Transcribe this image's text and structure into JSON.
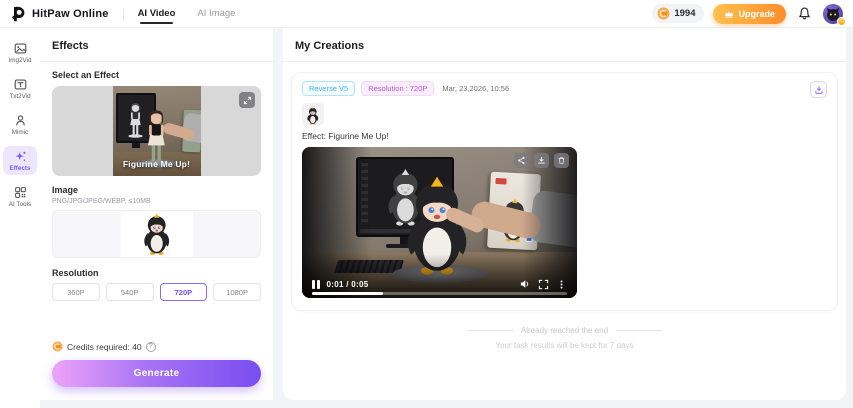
{
  "header": {
    "brand": "HitPaw Online",
    "tabs": [
      {
        "label": "AI Video",
        "active": true
      },
      {
        "label": "AI Image",
        "active": false
      }
    ],
    "credits": "1994",
    "upgrade_label": "Upgrade"
  },
  "sidebar": {
    "items": [
      {
        "label": "Img2Vid",
        "icon": "image-to-video-icon",
        "active": false
      },
      {
        "label": "Txt2Vid",
        "icon": "text-to-video-icon",
        "active": false
      },
      {
        "label": "Mimic",
        "icon": "person-icon",
        "active": false
      },
      {
        "label": "Effects",
        "icon": "sparkles-icon",
        "active": true
      },
      {
        "label": "AI Tools",
        "icon": "grid-tools-icon",
        "active": false
      }
    ]
  },
  "effects_panel": {
    "title": "Effects",
    "select_label": "Select an Effect",
    "effect_name": "Figurine Me Up!",
    "image_section": {
      "label": "Image",
      "formats": "PNG/JPG/JPEG/WEBP, ≤10MB"
    },
    "resolution": {
      "label": "Resolution",
      "options": [
        {
          "label": "360P",
          "selected": false
        },
        {
          "label": "540P",
          "selected": false
        },
        {
          "label": "720P",
          "selected": true
        },
        {
          "label": "1080P",
          "selected": false
        }
      ]
    },
    "credits_note": "Credits required: 40",
    "generate_label": "Generate"
  },
  "creations_panel": {
    "title": "My Creations",
    "card": {
      "model_badge": "Reverse V5",
      "resolution_badge": "Resolution : 720P",
      "timestamp": "Mar, 23,2026, 10:56",
      "effect_label": "Effect: Figurine Me Up!",
      "player": {
        "time_display": "0:01 / 0:05",
        "progress_percent": 28
      }
    },
    "end_message": "Already reached the end",
    "retention_message": "Your task results will be kept for 7 days"
  },
  "colors": {
    "accent_purple": "#7a5af5",
    "brand_orange": "#ff8d2a",
    "generate_gradient_start": "#eda4f8",
    "generate_gradient_end": "#7a4df0",
    "upgrade_gradient_start": "#ffc14e",
    "upgrade_gradient_end": "#ff8d2a",
    "badge_blue": "#41b4e6",
    "badge_purple": "#bb55e0",
    "coin_orange": "#f98e1d"
  },
  "icons": {
    "question": "?",
    "share": "share-nodes",
    "download": "arrow-down-tray",
    "delete": "trash",
    "expand": "arrows-expand",
    "bell": "bell",
    "crown": "crown"
  }
}
